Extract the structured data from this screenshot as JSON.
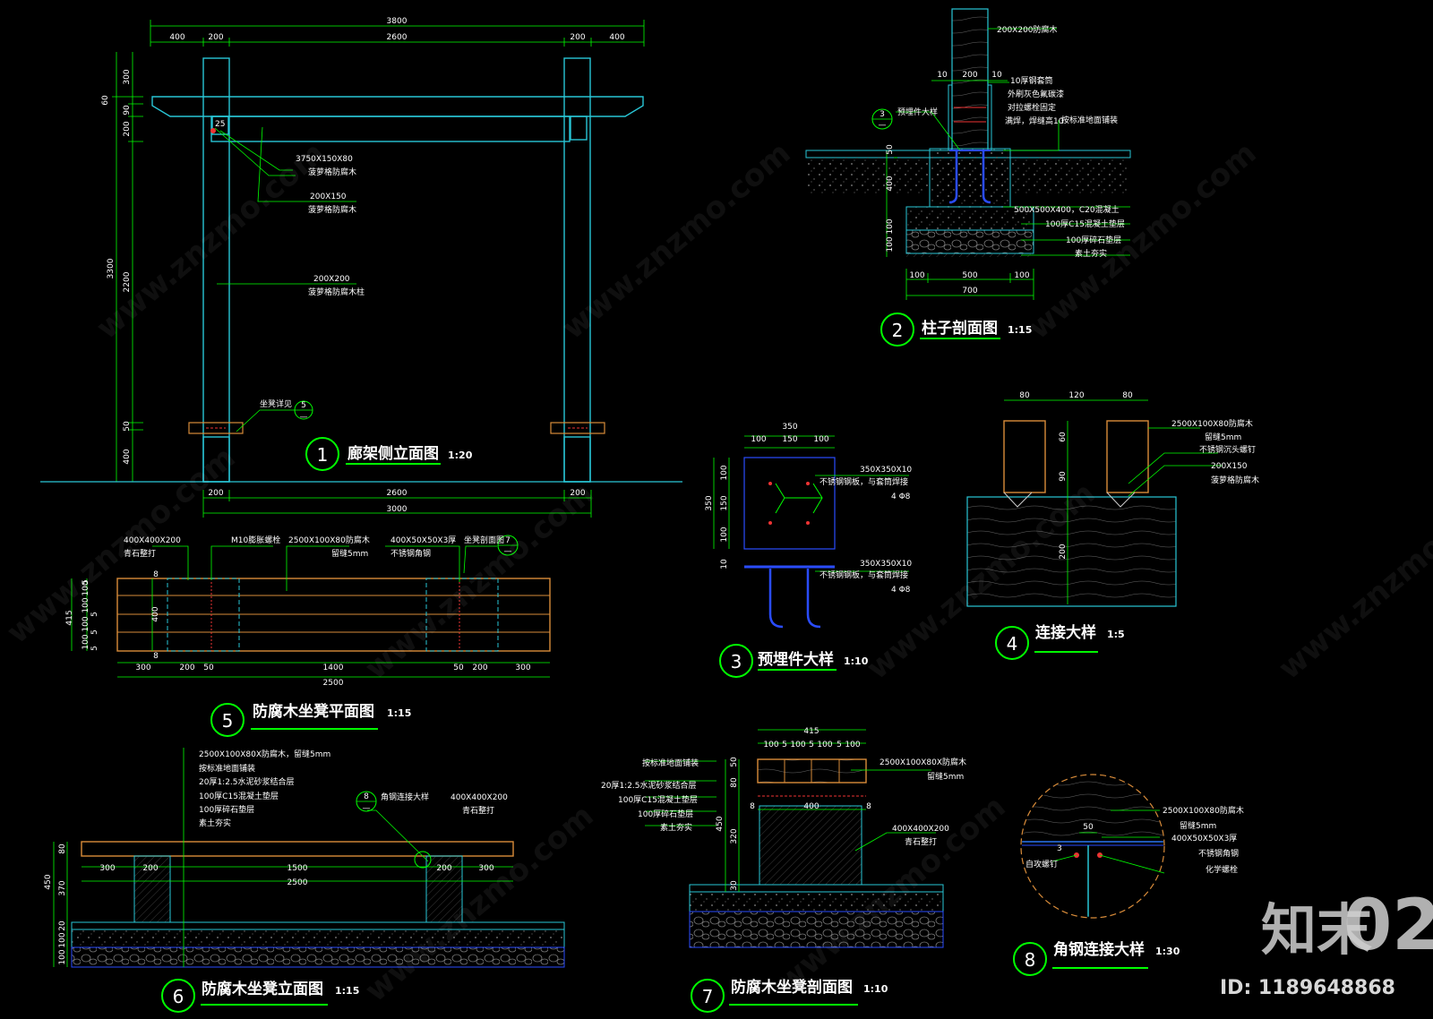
{
  "views": {
    "v1": {
      "num": "1",
      "title": "廊架侧立面图",
      "scale": "1:20"
    },
    "v2": {
      "num": "2",
      "title": "柱子剖面图",
      "scale": "1:15"
    },
    "v3": {
      "num": "3",
      "title": "预埋件大样",
      "scale": "1:10"
    },
    "v4": {
      "num": "4",
      "title": "连接大样",
      "scale": "1:5"
    },
    "v5": {
      "num": "5",
      "title": "防腐木坐凳平面图",
      "scale": "1:15"
    },
    "v6": {
      "num": "6",
      "title": "防腐木坐凳立面图",
      "scale": "1:15"
    },
    "v7": {
      "num": "7",
      "title": "防腐木坐凳剖面图",
      "scale": "1:10"
    },
    "v8": {
      "num": "8",
      "title": "角钢连接大样",
      "scale": "1:30"
    }
  },
  "v1": {
    "dims_top": [
      "3800",
      "400",
      "200",
      "2600",
      "200",
      "400"
    ],
    "dims_left": [
      "60",
      "300",
      "90",
      "200",
      "3300",
      "2200",
      "50",
      "400"
    ],
    "dims_bottom": [
      "200",
      "2600",
      "200",
      "3000"
    ],
    "tag": "25",
    "notes": [
      {
        "a": "3750X150X80",
        "b": "菠萝格防腐木"
      },
      {
        "a": "200X150",
        "b": "菠萝格防腐木"
      },
      {
        "a": "200X200",
        "b": "菠萝格防腐木柱"
      }
    ],
    "ref_label": "坐凳详见",
    "ref_num": "5",
    "ref_sub": "—"
  },
  "v2": {
    "top_note": "200X200防腐木",
    "dims_top": [
      "10",
      "200",
      "10"
    ],
    "ref_num": "3",
    "ref_sub": "—",
    "ref_label": "预埋件大样",
    "notes": [
      "10厚钢套筒",
      "外刷灰色氟碳漆",
      "对拉螺栓固定",
      "满焊，焊缝高10",
      "按标准地面铺装",
      "500X500X400，C20混凝土",
      "100厚C15混凝土垫层",
      "100厚碎石垫层",
      "素土夯实"
    ],
    "dims_left": [
      "50",
      "400",
      "100",
      "100"
    ],
    "dims_bottom": [
      "100",
      "500",
      "100",
      "700"
    ]
  },
  "v3": {
    "dims_top": [
      "350",
      "100",
      "150",
      "100"
    ],
    "dims_left": [
      "350",
      "100",
      "150",
      "100",
      "10"
    ],
    "notes": [
      {
        "a": "350X350X10",
        "b": "不锈钢钢板，与套筒焊接",
        "c": "4 Φ8"
      },
      {
        "a": "350X350X10",
        "b": "不锈钢钢板，与套筒焊接",
        "c": "4 Φ8"
      }
    ]
  },
  "v4": {
    "dims_top": [
      "80",
      "120",
      "80"
    ],
    "dims_left": [
      "60",
      "90",
      "200"
    ],
    "notes": [
      "2500X100X80防腐木",
      "留缝5mm",
      "不锈钢沉头螺钉",
      "200X150",
      "菠萝格防腐木"
    ]
  },
  "v5": {
    "notes_top": [
      {
        "a": "400X400X200",
        "b": "青石整打"
      },
      {
        "a": "M10膨胀螺栓",
        "b": ""
      },
      {
        "a": "2500X100X80防腐木",
        "b": "留缝5mm"
      },
      {
        "a": "400X50X50X3厚",
        "b": "不锈钢角钢"
      },
      {
        "a": "坐凳剖面图",
        "b": ""
      }
    ],
    "ref_num": "7",
    "ref_sub": "—",
    "dims_left": [
      "415",
      "5",
      "100",
      "100",
      "5",
      "100",
      "5",
      "100",
      "5",
      "8",
      "400",
      "8"
    ],
    "dims_bottom": [
      "300",
      "200",
      "50",
      "1400",
      "50",
      "200",
      "300",
      "2500"
    ]
  },
  "v6": {
    "notes": [
      "2500X100X80X防腐木，留缝5mm",
      "按标准地面铺装",
      "20厚1:2.5水泥砂浆结合层",
      "100厚C15混凝土垫层",
      "100厚碎石垫层",
      "素土夯实"
    ],
    "ref_num": "8",
    "ref_sub": "—",
    "ref_label": "角钢连接大样",
    "stone": {
      "a": "400X400X200",
      "b": "青石整打"
    },
    "dims_left": [
      "450",
      "80",
      "370",
      "20",
      "100",
      "100"
    ],
    "dims_bottom": [
      "300",
      "200",
      "1500",
      "200",
      "300",
      "2500"
    ]
  },
  "v7": {
    "dims_top": [
      "415",
      "100",
      "5",
      "100",
      "5",
      "100",
      "5",
      "100"
    ],
    "notes_left": [
      "按标准地面铺装",
      "20厚1:2.5水泥砂浆结合层",
      "100厚C15混凝土垫层",
      "100厚碎石垫层",
      "素土夯实"
    ],
    "notes_right": [
      {
        "a": "2500X100X80X防腐木",
        "b": "留缝5mm"
      },
      {
        "a": "400X400X200",
        "b": "青石整打"
      }
    ],
    "dims_left": [
      "50",
      "80",
      "450",
      "320",
      "30"
    ],
    "dims_mid": [
      "8",
      "400",
      "8"
    ]
  },
  "v8": {
    "notes": [
      "2500X100X80防腐木",
      "留缝5mm",
      "400X50X50X3厚",
      "不锈钢角钢",
      "化学螺栓",
      "自攻螺钉"
    ],
    "dims": [
      "50",
      "3"
    ]
  },
  "watermark": "www.znzmo.com",
  "brand": "知末",
  "page_no": "02",
  "id_label": "ID: 1189648868"
}
